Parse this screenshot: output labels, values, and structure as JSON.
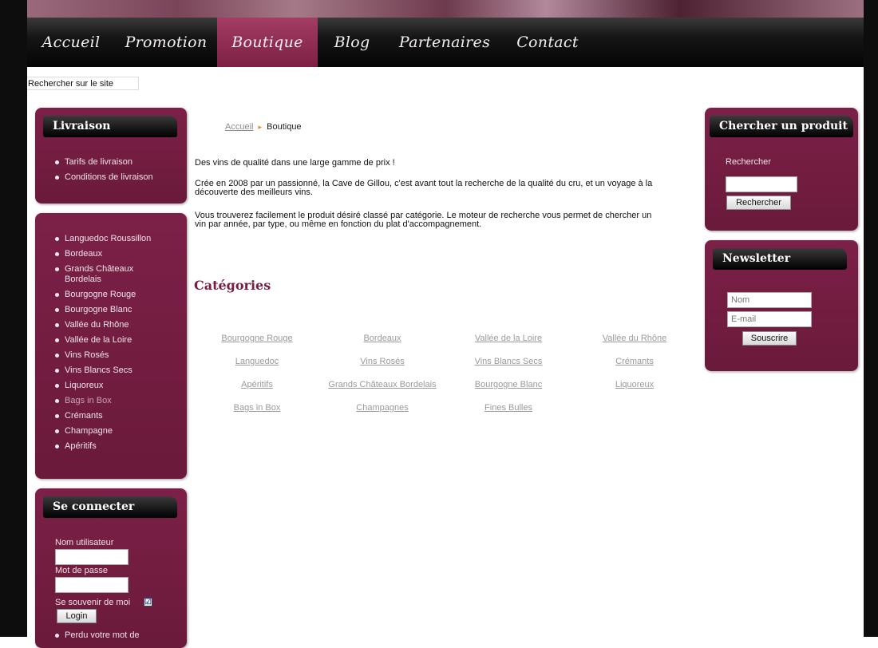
{
  "nav": {
    "items": [
      {
        "label": "Accueil"
      },
      {
        "label": "Promotion"
      },
      {
        "label": "Boutique"
      },
      {
        "label": "Blog"
      },
      {
        "label": "Partenaires"
      },
      {
        "label": "Contact"
      }
    ],
    "active": "Boutique"
  },
  "site_search": {
    "label": "Rechercher sur le site"
  },
  "livraison": {
    "title": "Livraison",
    "items": [
      "Tarifs de livraison",
      "Conditions de livraison"
    ]
  },
  "regions": {
    "items": [
      "Languedoc Roussillon",
      "Bordeaux",
      "Grands Châteaux",
      "Bordelais",
      "Bourgogne Rouge",
      "Bourgogne Blanc",
      "Vallée du Rhône",
      "Vallée de la Loire",
      "Vins Rosés",
      "Vins Blancs Secs",
      "Liquoreux",
      "Bags in Box",
      "Crémants",
      "Champagne",
      "Apéritifs"
    ]
  },
  "login": {
    "title": "Se connecter",
    "username_label": "Nom utilisateur",
    "password_label": "Mot de passe",
    "remember_label": "Se souvenir de moi",
    "remember_checked": "☑",
    "button": "Login",
    "forgot": "Perdu votre mot de"
  },
  "breadcrumb": {
    "home": "Accueil",
    "separator": "▸",
    "current": "Boutique"
  },
  "intro": {
    "p1": "Des vins de qualité dans une large gamme de prix !",
    "p2_line1": "Crée en 2008 par un passionné, la Cave de Gillou, c'est avant tout la recherche de la qualité du cru, et un voyage à la",
    "p2_line2": "découverte des meilleurs vins.",
    "p3_line1": "Vous trouverez facilement le produit désiré classé par catégorie. Le moteur de recherche vous permet de chercher un",
    "p3_line2": "vin par année, par type, ou même en fonction du plat d'accompagnement."
  },
  "categories": {
    "title": "Catégories",
    "rows": [
      [
        "Bourgogne Rouge",
        "Bordeaux",
        "Vallée de la Loire",
        "Vallée du Rhône"
      ],
      [
        "Languedoc",
        "Vins Rosés",
        "Vins Blancs Secs",
        "Crémants"
      ],
      [
        "Apéritifs",
        "Grands Châteaux Bordelais",
        "Bourgogne Blanc",
        "Liquoreux"
      ],
      [
        "Bags in Box",
        "Champagnes",
        "Fines Bulles"
      ]
    ]
  },
  "product_search": {
    "title": "Chercher un produit",
    "label": "Rechercher",
    "button": "Rechercher"
  },
  "newsletter": {
    "title": "Newsletter",
    "name_placeholder": "Nom",
    "email_placeholder": "E-mail",
    "button": "Souscrire"
  }
}
